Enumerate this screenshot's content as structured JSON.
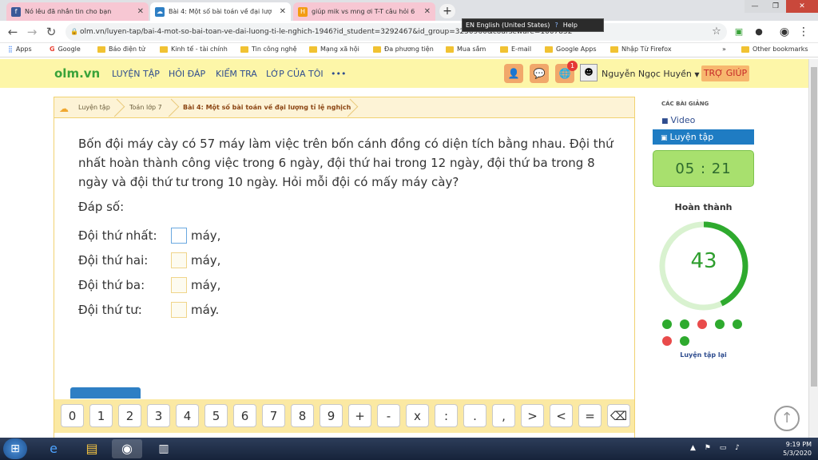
{
  "browser": {
    "tabs": [
      {
        "title": "Nó lêu đã nhắn tin cho bạn",
        "favicon": "facebook-icon",
        "color": "#3b5998",
        "glyph": "f"
      },
      {
        "title": "Bài 4: Một số bài toán về đại lượ",
        "favicon": "olm-cloud-icon",
        "color": "#2e7fc4",
        "glyph": "☁"
      },
      {
        "title": "giúp mik vs mng ơi T-T câu hỏi 6",
        "favicon": "hoc24-icon",
        "color": "#f39c12",
        "glyph": "H"
      }
    ],
    "new_tab": "+",
    "language_bar": {
      "language": "EN English (United States)",
      "help": "Help"
    },
    "url": "olm.vn/luyen-tap/bai-4-mot-so-bai-toan-ve-dai-luong-ti-le-nghich-1946?id_student=3292467&id_group=3250960&courseware=1007852",
    "bookmarks": [
      "Apps",
      "Google",
      "Báo điện tử",
      "Kinh tế - tài chính",
      "Tin công nghệ",
      "Mạng xã hội",
      "Đa phương tiện",
      "Mua sắm",
      "E-mail",
      "Google Apps",
      "Nhập Từ Firefox"
    ],
    "more_bookmarks": "»",
    "other_bookmarks": "Other bookmarks"
  },
  "site": {
    "logo": "olm.vn",
    "nav": [
      "LUYỆN TẬP",
      "HỎI ĐÁP",
      "KIỂM TRA",
      "LỚP CỦA TÔI",
      "•••"
    ],
    "notification_count": "1",
    "user_name": "Nguyễn Ngọc Huyền",
    "help_button": "TRỢ GIÚP"
  },
  "breadcrumb": [
    "Luyện tập",
    "Toán lớp 7",
    "Bài 4: Một số bài toán về đại lượng tỉ lệ nghịch"
  ],
  "question": {
    "text": "Bốn đội máy cày có 57 máy làm việc trên bốn cánh đồng có diện tích bằng nhau. Đội thứ nhất hoàn thành công việc trong 6 ngày, đội thứ hai trong 12 ngày, đội thứ ba trong 8 ngày và đội thứ tư trong 10 ngày. Hỏi mỗi đội có mấy máy cày?",
    "answer_label": "Đáp số:",
    "rows": [
      {
        "label": "Đội thứ nhất:",
        "unit": "máy,"
      },
      {
        "label": "Đội thứ hai:",
        "unit": "máy,"
      },
      {
        "label": "Đội thứ ba:",
        "unit": "máy,"
      },
      {
        "label": "Đội thứ tư:",
        "unit": "máy."
      }
    ]
  },
  "keypad": [
    "0",
    "1",
    "2",
    "3",
    "4",
    "5",
    "6",
    "7",
    "8",
    "9",
    "+",
    "-",
    "x",
    ":",
    ".",
    ",",
    ">",
    "<",
    "=",
    "⌫"
  ],
  "sidebar": {
    "lessons_title": "CÁC BÀI GIẢNG",
    "video": "Video",
    "practice": "Luyện tập",
    "timer": "05 : 21",
    "done_label": "Hoàn thành",
    "score": "43",
    "score_fraction": 0.43,
    "results": [
      "correct",
      "correct",
      "wrong",
      "correct",
      "correct",
      "wrong",
      "correct"
    ],
    "correct_color": "#2eaa2e",
    "wrong_color": "#e94b4b",
    "redo": "Luyện tập lại"
  },
  "taskbar": {
    "time": "9:19 PM",
    "date": "5/3/2020"
  }
}
